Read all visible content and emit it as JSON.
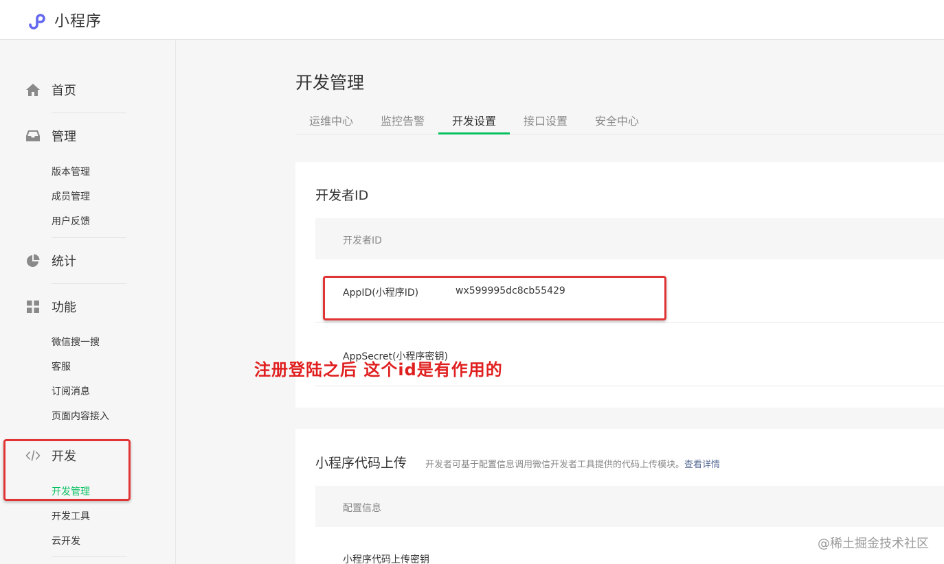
{
  "app": {
    "title": "小程序"
  },
  "sidebar": {
    "sections": [
      {
        "label": "首页",
        "icon": "home-icon"
      },
      {
        "label": "管理",
        "icon": "inbox-icon",
        "items": [
          "版本管理",
          "成员管理",
          "用户反馈"
        ]
      },
      {
        "label": "统计",
        "icon": "pie-chart-icon"
      },
      {
        "label": "功能",
        "icon": "grid-icon",
        "items": [
          "微信搜一搜",
          "客服",
          "订阅消息",
          "页面内容接入"
        ]
      },
      {
        "label": "开发",
        "icon": "code-icon",
        "items": [
          "开发管理",
          "开发工具",
          "云开发"
        ]
      }
    ],
    "active_item": "开发管理"
  },
  "page": {
    "title": "开发管理",
    "tabs": [
      "运维中心",
      "监控告警",
      "开发设置",
      "接口设置",
      "安全中心"
    ],
    "active_tab": "开发设置"
  },
  "developer_id": {
    "title": "开发者ID",
    "table_header": "开发者ID",
    "rows": [
      {
        "label": "AppID(小程序ID)",
        "value": "wx599995dc8cb55429"
      },
      {
        "label": "AppSecret(小程序密钥)",
        "value": ""
      }
    ]
  },
  "code_upload": {
    "title": "小程序代码上传",
    "description": "开发者可基于配置信息调用微信开发者工具提供的代码上传模块。",
    "link": "查看详情",
    "table_header": "配置信息",
    "rows": [
      {
        "label": "小程序代码上传密钥"
      }
    ]
  },
  "annotation": {
    "text": "注册登陆之后 这个id是有作用的"
  },
  "watermark": {
    "text": "@稀土掘金技术社区"
  },
  "colors": {
    "accent": "#07c160",
    "annotation_red": "#e13434",
    "link": "#576b95"
  }
}
